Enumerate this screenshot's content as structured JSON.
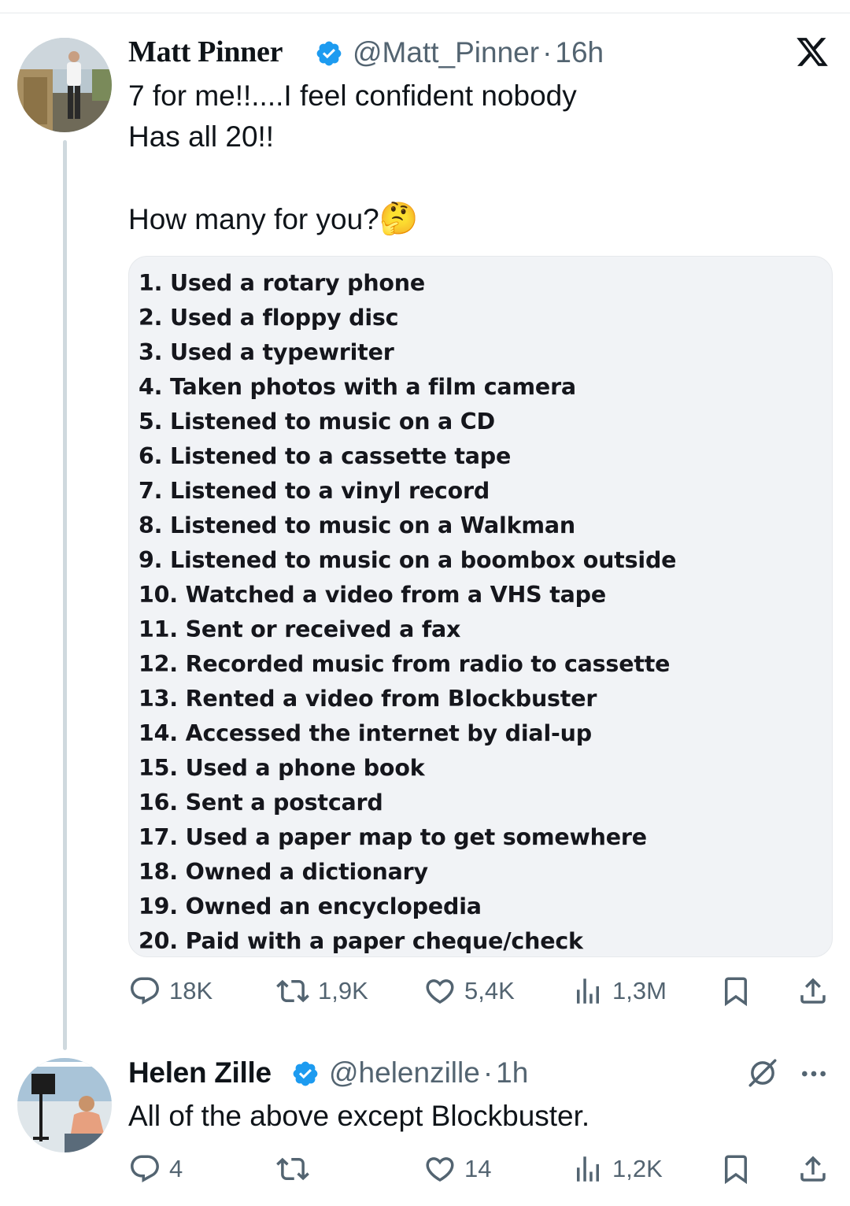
{
  "tweet": {
    "author_name": "Matt Pinner",
    "handle": "@Matt_Pinner",
    "separator": "·",
    "time": "16h",
    "text_line1": "7 for me!!....I feel confident nobody",
    "text_line2": "Has all 20!!",
    "text_line3": "How many for you?",
    "emoji": "🤔",
    "list_items": [
      "1. Used a rotary phone",
      "2. Used a floppy disc",
      "3. Used a typewriter",
      "4. Taken photos with a film camera",
      "5. Listened to music on a CD",
      "6. Listened to a cassette tape",
      "7. Listened to a vinyl record",
      "8. Listened to music on a Walkman",
      "9. Listened to music on a boombox outside",
      "10. Watched a video from a VHS tape",
      "11. Sent or received a fax",
      "12. Recorded music from radio to cassette",
      "13. Rented a video from Blockbuster",
      "14. Accessed the internet by dial-up",
      "15. Used a phone book",
      "16. Sent a postcard",
      "17. Used a paper map to get somewhere",
      "18. Owned a dictionary",
      "19. Owned an encyclopedia",
      "20. Paid with a paper cheque/check"
    ],
    "replies": "18K",
    "reposts": "1,9K",
    "likes": "5,4K",
    "views": "1,3M"
  },
  "reply": {
    "author_name": "Helen Zille",
    "handle": "@helenzille",
    "separator": "·",
    "time": "1h",
    "text": "All of the above except Blockbuster.",
    "replies": "4",
    "reposts": "",
    "likes": "14",
    "views": "1,2K"
  },
  "icons": {
    "close": "x-logo-icon",
    "verified": "verified-badge-icon",
    "reply": "reply-icon",
    "repost": "repost-icon",
    "like": "like-icon",
    "views": "views-icon",
    "bookmark": "bookmark-icon",
    "share": "share-icon",
    "grok": "grok-icon",
    "more": "more-icon"
  },
  "colors": {
    "verified": "#1d9bf0",
    "text": "#0f1419",
    "secondary": "#536471",
    "thread_line": "#cfd9de"
  }
}
